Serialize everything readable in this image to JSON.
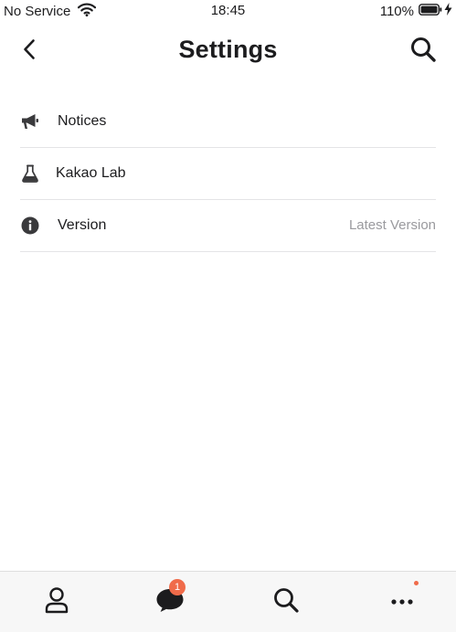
{
  "status_bar": {
    "carrier": "No Service",
    "time": "18:45",
    "battery_percent": "110%"
  },
  "header": {
    "title": "Settings"
  },
  "settings": {
    "items": [
      {
        "label": "Notices",
        "icon": "megaphone-icon"
      },
      {
        "label": "Kakao Lab",
        "icon": "flask-icon"
      },
      {
        "label": "Version",
        "icon": "info-icon",
        "value": "Latest Version"
      }
    ]
  },
  "tab_bar": {
    "tabs": [
      {
        "icon": "person-icon"
      },
      {
        "icon": "chat-bubble-icon",
        "badge": "1"
      },
      {
        "icon": "search-icon"
      },
      {
        "icon": "more-icon",
        "has_dot": true
      }
    ]
  },
  "colors": {
    "badge": "#f06b4a",
    "text": "#1c1c1e",
    "secondary_text": "#9a9a9e",
    "tab_bar_bg": "#f7f7f7"
  }
}
